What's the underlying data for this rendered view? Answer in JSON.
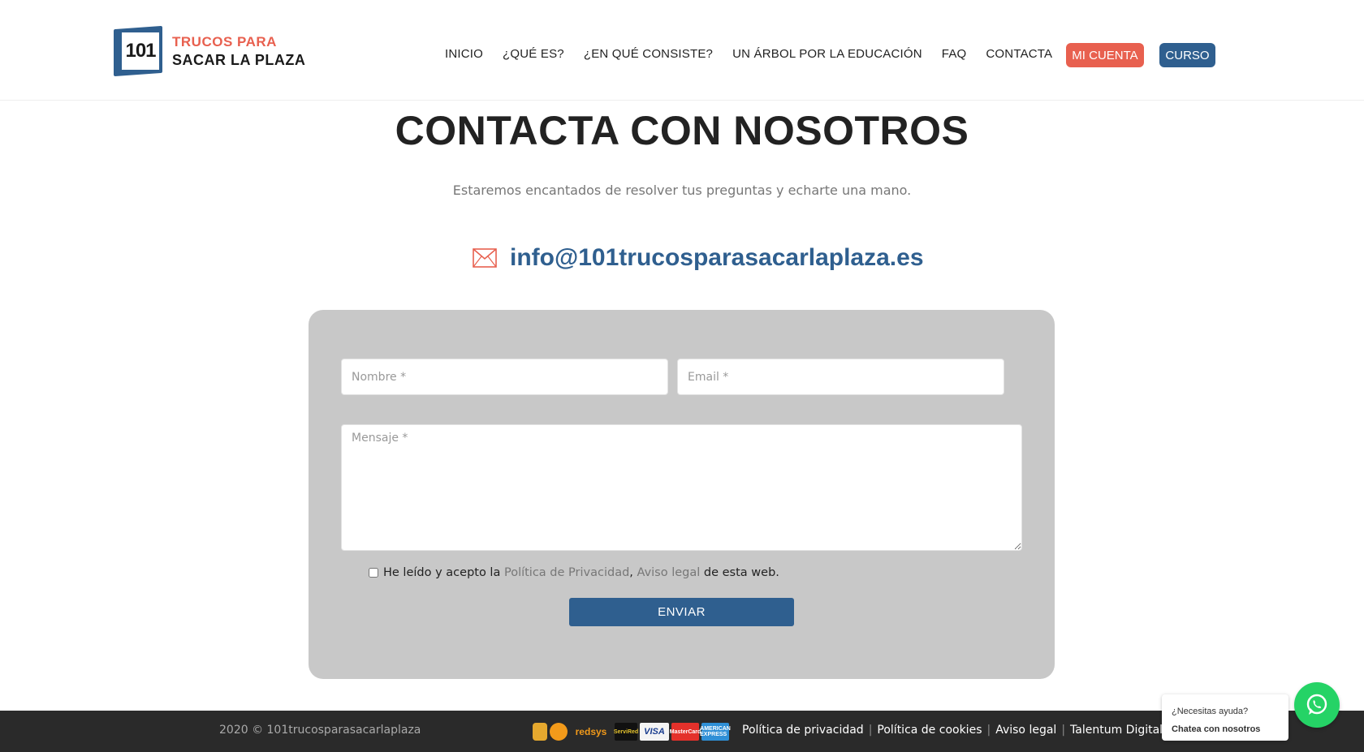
{
  "header": {
    "logo": {
      "number": "101",
      "line1": "TRUCOS PARA",
      "line2": "SACAR LA PLAZA"
    },
    "nav": [
      {
        "label": "INICIO"
      },
      {
        "label": "¿QUÉ ES?"
      },
      {
        "label": "¿EN QUÉ CONSISTE?"
      },
      {
        "label": "UN ÁRBOL POR LA EDUCACIÓN"
      },
      {
        "label": "FAQ"
      },
      {
        "label": "CONTACTA"
      }
    ],
    "mi_cuenta_label": "MI CUENTA",
    "curso_label": "CURSO"
  },
  "main": {
    "title": "CONTACTA CON NOSOTROS",
    "subtitle": "Estaremos encantados de resolver tus preguntas y echarte una mano.",
    "email": "info@101trucosparasacarlaplaza.es"
  },
  "form": {
    "nombre_placeholder": "Nombre *",
    "email_placeholder": "Email *",
    "mensaje_placeholder": "Mensaje *",
    "consent_prefix": "He leído y acepto la ",
    "consent_link1": "Política de Privacidad",
    "consent_comma": ", ",
    "consent_link2": "Aviso legal",
    "consent_suffix": " de esta web.",
    "submit_label": "ENVIAR"
  },
  "footer": {
    "copyright": "2020 © 101trucosparasacarlaplaza",
    "payments": {
      "redsys": "redsys",
      "servired": "ServiRed",
      "visa": "VISA",
      "mastercard": "MasterCard",
      "amex": "AMERICAN EXPRESS"
    },
    "links": [
      {
        "label": "Política de privacidad"
      },
      {
        "label": "Política de cookies"
      },
      {
        "label": "Aviso legal"
      },
      {
        "label": "Talentum Digital"
      }
    ],
    "separator": "|"
  },
  "whatsapp": {
    "prompt": "¿Necesitas ayuda?",
    "cta": "Chatea con nosotros"
  },
  "colors": {
    "brand_blue": "#2f5f8f",
    "brand_coral": "#e8604f",
    "form_bg": "#c8c8c8",
    "footer_bg": "#2a2a2a",
    "whatsapp_green": "#25d366"
  }
}
